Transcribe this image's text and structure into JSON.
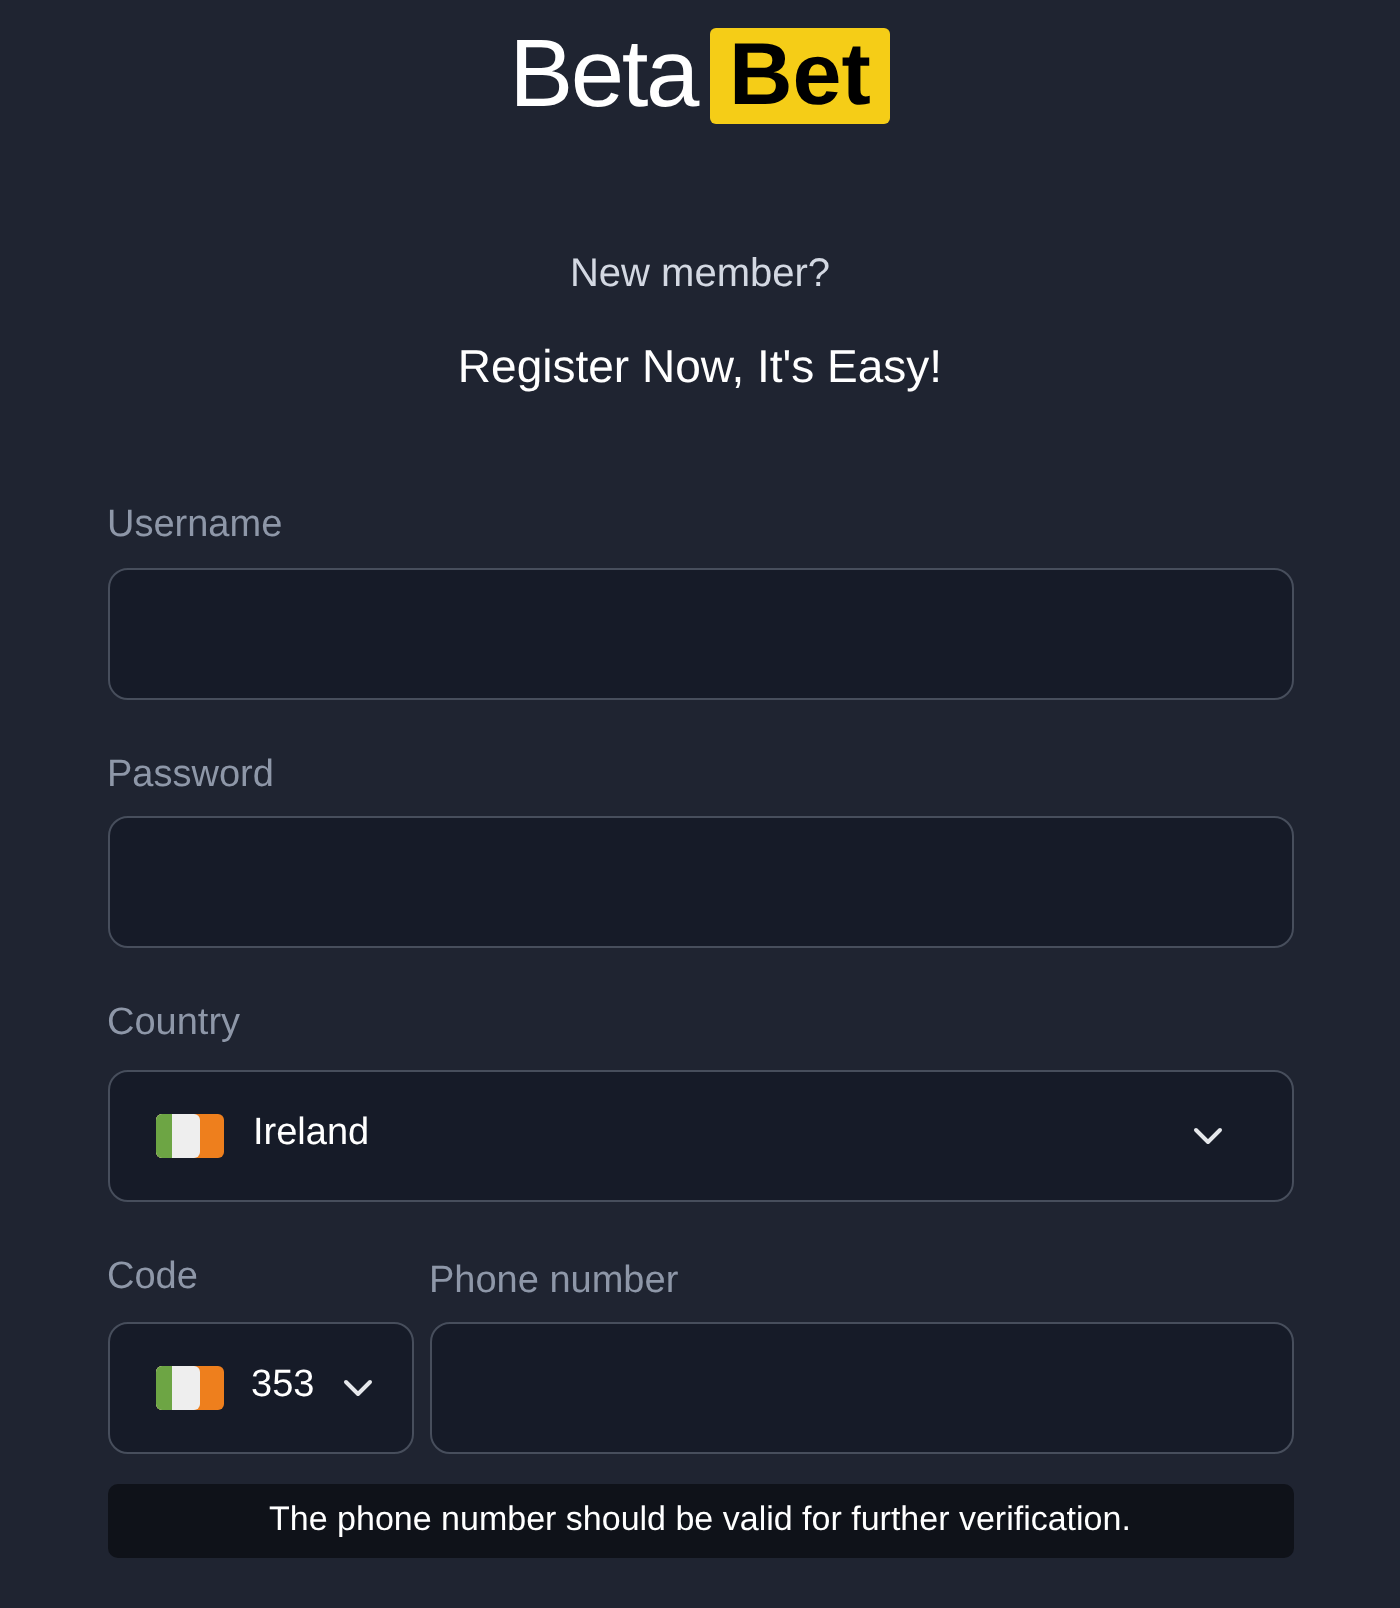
{
  "logo": {
    "light": "Beta",
    "badge": "Bet"
  },
  "intro": {
    "question": "New member?",
    "headline": "Register Now, It's Easy!"
  },
  "username": {
    "label": "Username"
  },
  "password": {
    "label": "Password"
  },
  "country": {
    "label": "Country",
    "value": "Ireland"
  },
  "code": {
    "label": "Code",
    "value": "353"
  },
  "phone": {
    "label": "Phone number"
  },
  "hint": "The phone number should be valid for further verification."
}
